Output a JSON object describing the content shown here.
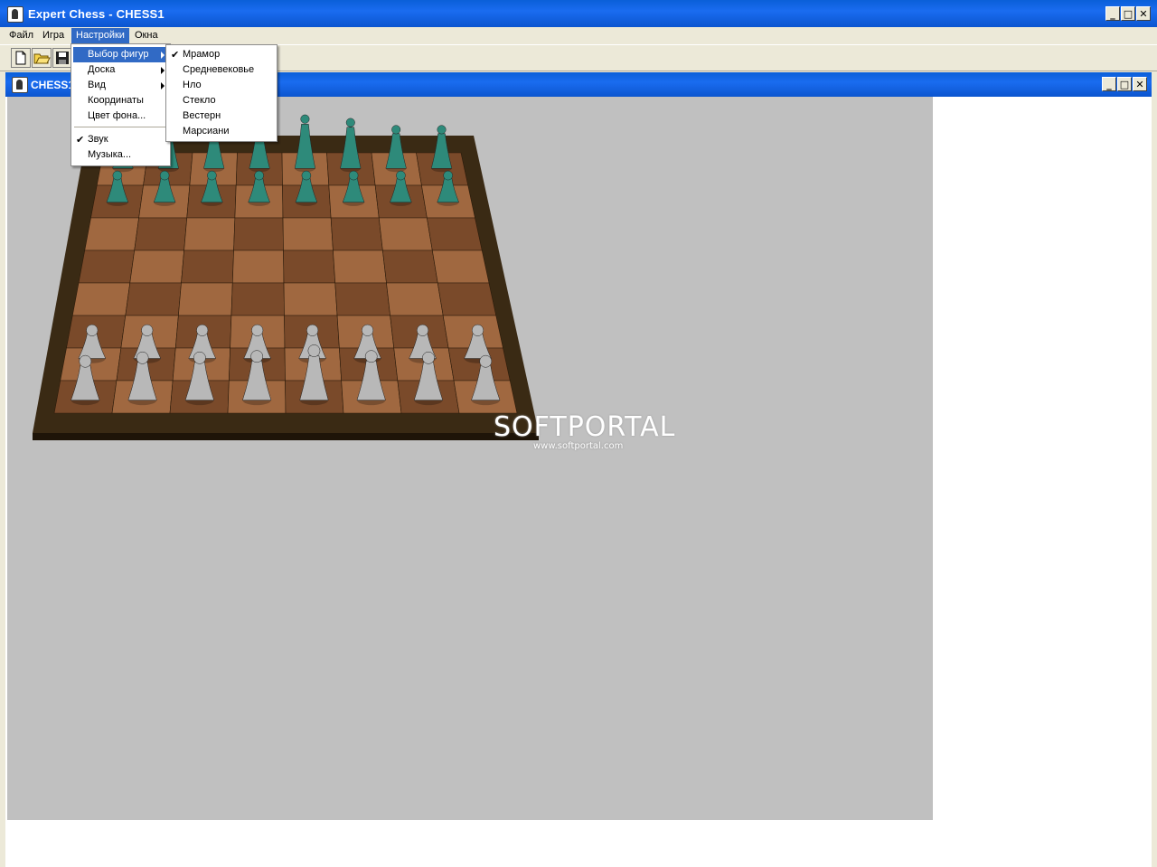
{
  "app": {
    "title": "Expert Chess - CHESS1"
  },
  "menubar": {
    "items": [
      "Файл",
      "Игра",
      "Настройки",
      "Окна"
    ]
  },
  "child": {
    "title": "CHESS1"
  },
  "settings_menu": {
    "items": [
      "Выбор фигур",
      "Доска",
      "Вид",
      "Координаты",
      "Цвет фона...",
      "Звук",
      "Музыка..."
    ]
  },
  "pieces_submenu": {
    "items": [
      "Мрамор",
      "Средневековье",
      "Нло",
      "Стекло",
      "Вестерн",
      "Марсиани"
    ],
    "checked": "Мрамор"
  },
  "watermark": {
    "brand": "SOFTPORTAL",
    "url": "www.softportal.com"
  },
  "colors": {
    "titlebar": "#0b55cf",
    "menu_highlight": "#316ac5",
    "canvas_bg": "#c0c0c0",
    "board_frame": "#3a2a14",
    "board_dark": "#7a4a2a",
    "board_light": "#a06840",
    "black_pieces": "#2e8a7a",
    "white_pieces": "#b8b8b8"
  },
  "icons": {
    "app": "chess-knight-icon",
    "new": "new-file-icon",
    "open": "open-folder-icon",
    "save": "save-disk-icon"
  }
}
